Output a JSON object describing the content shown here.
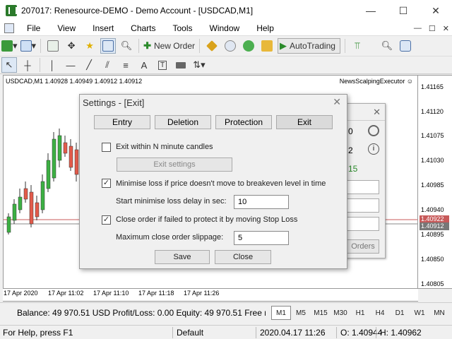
{
  "window": {
    "title": "207017: Renesource-DEMO - Demo Account - [USDCAD,M1]",
    "minimize": "—",
    "maximize": "☐",
    "close": "✕"
  },
  "menu": {
    "items": [
      "File",
      "View",
      "Insert",
      "Charts",
      "Tools",
      "Window",
      "Help"
    ],
    "right": [
      "—",
      "☐",
      "✕"
    ]
  },
  "toolbar": {
    "new_order": "New Order",
    "autotrading": "AutoTrading"
  },
  "chart": {
    "info": "USDCAD,M1  1.40928 1.40949 1.40912 1.40912",
    "ea_name": "NewsScalpingExecutor ☺",
    "price_labels": [
      "1.41165",
      "1.41120",
      "1.41075",
      "1.41030",
      "1.40985",
      "1.40940",
      "1.40895",
      "1.40850",
      "1.40805"
    ],
    "price_tags": [
      "1.40922",
      "1.40912"
    ],
    "time_labels": [
      "17 Apr 2020",
      "17 Apr 11:02",
      "17 Apr 11:10",
      "17 Apr 11:18",
      "17 Apr 11:26"
    ]
  },
  "ea_panel": {
    "values": [
      "0",
      "2",
      "15"
    ],
    "orders_btn": "Orders"
  },
  "dialog": {
    "title": "Settings - [Exit]",
    "close": "✕",
    "tabs": [
      "Entry",
      "Deletion",
      "Protection",
      "Exit"
    ],
    "exit_n_min": {
      "label": "Exit within N minute candles",
      "checked": false
    },
    "exit_settings_btn": "Exit settings",
    "minimise_loss": {
      "label": "Minimise loss if price doesn't move to breakeven level in time",
      "checked": true
    },
    "start_delay": {
      "label": "Start minimise loss delay in sec:",
      "value": "10"
    },
    "close_failed": {
      "label": "Close order if failed to protect it by moving Stop Loss",
      "checked": true
    },
    "max_slippage": {
      "label": "Maximum close order slippage:",
      "value": "5"
    },
    "save_btn": "Save",
    "close_btn": "Close"
  },
  "account": {
    "text": "Balance: 49 970.51 USD  Profit/Loss: 0.00  Equity: 49 970.51  Free n"
  },
  "timeframes": [
    "M1",
    "M5",
    "M15",
    "M30",
    "H1",
    "H4",
    "D1",
    "W1",
    "MN"
  ],
  "status": {
    "help": "For Help, press F1",
    "profile": "Default",
    "datetime": "2020.04.17 11:26",
    "open": "O: 1.40944",
    "high": "H: 1.40962"
  }
}
